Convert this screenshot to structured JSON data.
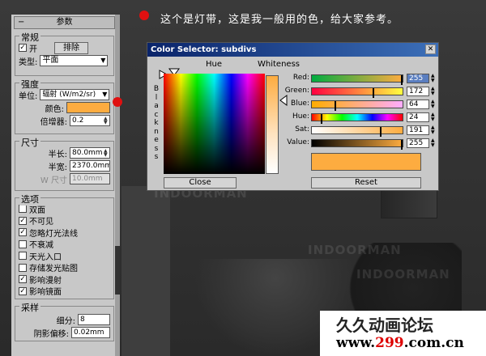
{
  "annotation": "这个是灯带，这是我一般用的色，给大家参考。",
  "panel": {
    "title": "参数",
    "general": {
      "label": "常规",
      "on_label": "开",
      "exclude_label": "排除",
      "type_label": "类型:",
      "type_value": "平面"
    },
    "intensity": {
      "label": "强度",
      "unit_label": "单位:",
      "unit_value": "辐射 (W/m2/sr)",
      "color_label": "颜色:",
      "multiplier_label": "倍增器:",
      "multiplier_value": "0.2"
    },
    "size": {
      "label": "尺寸",
      "half_length_label": "半长:",
      "half_length_value": "80.0mm",
      "half_width_label": "半宽:",
      "half_width_value": "2370.0mm",
      "w_size_label": "W 尺寸",
      "w_size_value": "10.0mm"
    },
    "options": {
      "label": "选项",
      "items": [
        {
          "label": "双面",
          "checked": false
        },
        {
          "label": "不可见",
          "checked": true
        },
        {
          "label": "忽略灯光法线",
          "checked": true
        },
        {
          "label": "不衰减",
          "checked": false
        },
        {
          "label": "天光入口",
          "checked": false
        },
        {
          "label": "存储发光贴图",
          "checked": false
        },
        {
          "label": "影响漫射",
          "checked": true
        },
        {
          "label": "影响镜面",
          "checked": true
        }
      ]
    },
    "sampling": {
      "label": "采样",
      "subdivs_label": "细分:",
      "subdivs_value": "8",
      "shadow_bias_label": "阴影偏移:",
      "shadow_bias_value": "0.02mm"
    }
  },
  "dialog": {
    "title": "Color Selector: subdivs",
    "hue_label": "Hue",
    "whiteness_label": "Whiteness",
    "blackness_label": "Blackness",
    "sliders": [
      {
        "label": "Red:",
        "value": "255",
        "fraction": 1.0
      },
      {
        "label": "Green:",
        "value": "172",
        "fraction": 0.674
      },
      {
        "label": "Blue:",
        "value": "64",
        "fraction": 0.251
      },
      {
        "label": "Hue:",
        "value": "24",
        "fraction": 0.094
      },
      {
        "label": "Sat:",
        "value": "191",
        "fraction": 0.749
      },
      {
        "label": "Value:",
        "value": "255",
        "fraction": 1.0
      }
    ],
    "close_label": "Close",
    "reset_label": "Reset",
    "color": "#fdac40"
  },
  "logo": {
    "name": "久久动画论坛",
    "url_prefix": "www.",
    "url_highlight": "299",
    "url_suffix": ".com.cn"
  },
  "watermark": "INDOORMAN"
}
